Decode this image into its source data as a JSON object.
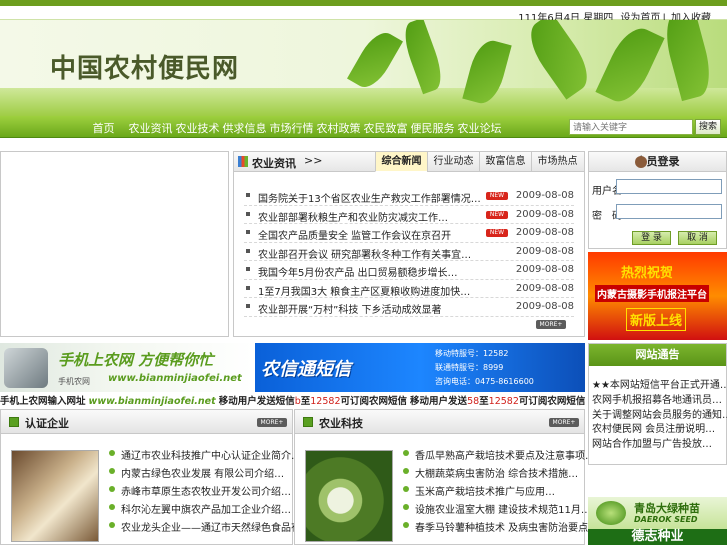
{
  "header": {
    "date_text": "111年6月4日 星期四",
    "links": [
      "设为首页",
      "加入收藏"
    ],
    "logo": "中国农村便民网"
  },
  "nav": {
    "items": [
      "首页",
      "农业资讯",
      "农业技术",
      "供求信息",
      "市场行情",
      "农村政策",
      "农民致富",
      "便民服务",
      "农业论坛"
    ],
    "search_placeholder": "请输入关键字",
    "search_button": "搜索"
  },
  "news": {
    "title": "农业资讯",
    "arrow": ">>",
    "tabs": [
      "综合新闻",
      "行业动态",
      "致富信息",
      "市场热点"
    ],
    "active_tab": 0,
    "items": [
      {
        "title": "国务院关于13个省区农业生产救灾工作部署情况…",
        "date": "2009-08-08",
        "new": true
      },
      {
        "title": "农业部部署秋粮生产和农业防灾减灾工作…",
        "date": "2009-08-08",
        "new": true
      },
      {
        "title": "全国农产品质量安全 监管工作会议在京召开",
        "date": "2009-08-08",
        "new": true
      },
      {
        "title": "农业部召开会议 研究部署秋冬种工作有关事宜…",
        "date": "2009-08-08",
        "new": false
      },
      {
        "title": "我国今年5月份农产品 出口贸易额稳步增长…",
        "date": "2009-08-08",
        "new": false
      },
      {
        "title": "1至7月我国3大 粮食主产区夏粮收购进度加快…",
        "date": "2009-08-08",
        "new": false
      },
      {
        "title": "农业部开展“万村”科技 下乡活动成效显著",
        "date": "2009-08-08",
        "new": false
      }
    ],
    "new_badge": "NEW",
    "more": "MORE+"
  },
  "login": {
    "title": "会员登录",
    "user_label": "用户名",
    "pass_label": "密　码",
    "login_button": "登 录",
    "cancel_button": "取 消"
  },
  "promo": {
    "line1": "热烈祝贺",
    "line2": "内蒙古摄影手机报注平台",
    "line3": "新版上线"
  },
  "ad_mobile": {
    "slogan": "手机上农网 方便帮你忙",
    "brand": "手机农网",
    "url": "www.bianminjiaofei.net"
  },
  "ad_sms": {
    "title": "农信通短信",
    "lines": [
      "移动特服号：12582",
      "联通特服号：8999",
      "咨询电话：0475-8616600"
    ]
  },
  "ticker": {
    "label": "手机上农网输入网址",
    "url": "www.bianminjiaofei.net",
    "text1": "移动用户发送短信",
    "code1": "b",
    "text2": "至",
    "num1": "12582",
    "text3": "可订阅农网短信",
    "text4": "移动用户发送",
    "code2": "58",
    "text5": "至",
    "num2": "12582",
    "text6": "可订阅农网短信"
  },
  "section_left": {
    "title": "认证企业",
    "more": "MORE+",
    "items": [
      "通辽市农业科技推广中心认证企业简介…",
      "内蒙古绿色农业发展 有限公司介绍…",
      "赤峰市草原生态农牧业开发公司介绍…",
      "科尔沁左翼中旗农产品加工企业介绍…",
      "农业龙头企业——通辽市天然绿色食品有限公司"
    ]
  },
  "section_right": {
    "title": "农业科技",
    "more": "MORE+",
    "items": [
      "香瓜早熟高产栽培技术要点及注意事项…",
      "大棚蔬菜病虫害防治 综合技术措施…",
      "玉米高产栽培技术推广与应用…",
      "设施农业温室大棚 建设技术规范11月…",
      "春季马铃薯种植技术 及病虫害防治要点"
    ]
  },
  "tonggao": {
    "title": "网站通告",
    "items": [
      "★★本网站短信平台正式开通…",
      "农网手机报招募各地通讯员…",
      "关于调整网站会员服务的通知…",
      "农村便民网 会员注册说明…",
      "网站合作加盟与广告投放…"
    ]
  },
  "seed_ad": {
    "name": "青岛大绿种苗",
    "en": "DAEROK SEED",
    "bottom": "德志种业"
  }
}
